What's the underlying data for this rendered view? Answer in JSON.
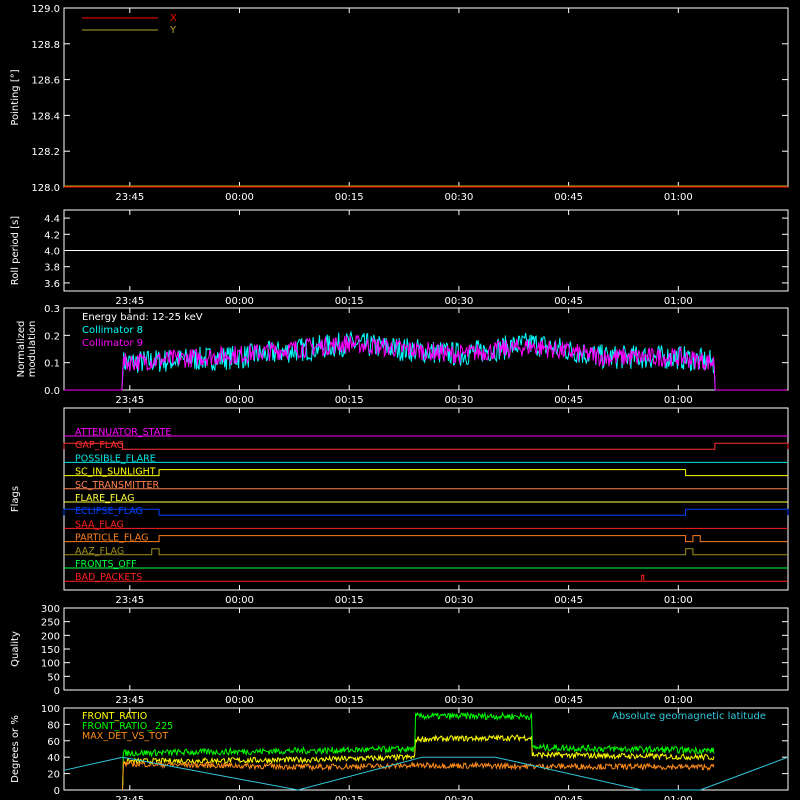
{
  "time_ticks": [
    "23:45",
    "00:00",
    "00:15",
    "00:30",
    "00:45",
    "01:00"
  ],
  "colors": {
    "background": "#000000",
    "axes": "#ffffff",
    "x": "#ff0000",
    "y": "#b5a32a",
    "roll": "#ffffff",
    "coll8": "#00ffff",
    "coll9": "#ff00ff",
    "front_ratio": "#ffff00",
    "front_ratio_225": "#00ff00",
    "max_det": "#ff8c1a",
    "geomag": "#32c8dc"
  },
  "chart_data": [
    {
      "id": "pointing",
      "type": "line",
      "ylabel": "Pointing [°]",
      "ylim": [
        128.0,
        129.0
      ],
      "yticks": [
        "128.0",
        "128.2",
        "128.4",
        "128.6",
        "128.8",
        "129.0"
      ],
      "legend": [
        "X",
        "Y"
      ],
      "series": [
        {
          "name": "X",
          "x": [
            "23:36",
            "01:15"
          ],
          "y": [
            128.0,
            128.0
          ]
        },
        {
          "name": "Y",
          "x": [
            "23:36",
            "01:15"
          ],
          "y": [
            128.0,
            128.0
          ]
        }
      ]
    },
    {
      "id": "roll",
      "type": "line",
      "ylabel": "Roll period [s]",
      "ylim": [
        3.5,
        4.5
      ],
      "yticks": [
        "3.6",
        "3.8",
        "4.0",
        "4.2",
        "4.4"
      ],
      "series": [
        {
          "x": [
            "23:36",
            "01:15"
          ],
          "y": [
            4.0,
            4.0
          ]
        }
      ]
    },
    {
      "id": "modulation",
      "type": "line",
      "ylabel": "Normalized modulation",
      "ylim": [
        0.0,
        0.3
      ],
      "yticks": [
        "0.0",
        "0.1",
        "0.2",
        "0.3"
      ],
      "annotation": "Energy band: 12-25 keV",
      "legend": [
        "Collimator 8",
        "Collimator 9"
      ],
      "series": [
        {
          "name": "Collimator 8",
          "x": [
            "23:36",
            "23:44",
            "23:44",
            "00:00",
            "00:15",
            "00:30",
            "00:40",
            "00:50",
            "01:00",
            "01:05",
            "01:05",
            "01:15"
          ],
          "y": [
            0.0,
            0.0,
            0.1,
            0.12,
            0.17,
            0.13,
            0.17,
            0.12,
            0.12,
            0.1,
            0.0,
            0.0
          ]
        },
        {
          "name": "Collimator 9",
          "x": [
            "23:36",
            "23:44",
            "23:44",
            "00:00",
            "00:15",
            "00:30",
            "00:40",
            "00:50",
            "01:00",
            "01:05",
            "01:05",
            "01:15"
          ],
          "y": [
            0.0,
            0.0,
            0.1,
            0.13,
            0.17,
            0.13,
            0.16,
            0.12,
            0.12,
            0.1,
            0.0,
            0.0
          ]
        }
      ]
    },
    {
      "id": "flags",
      "type": "line",
      "ylabel": "Flags",
      "flags": [
        {
          "name": "ATTENUATOR_STATE",
          "color": "#ff00ff",
          "on": []
        },
        {
          "name": "GAP_FLAG",
          "color": "#ff3030",
          "on": [
            [
              "23:36",
              "23:44"
            ],
            [
              "01:05",
              "01:15"
            ]
          ]
        },
        {
          "name": "POSSIBLE_FLARE",
          "color": "#00e5e5",
          "on": []
        },
        {
          "name": "SC_IN_SUNLIGHT",
          "color": "#ffff00",
          "on": [
            [
              "23:49",
              "01:01"
            ]
          ]
        },
        {
          "name": "SC_TRANSMITTER",
          "color": "#ff7f50",
          "on": []
        },
        {
          "name": "FLARE_FLAG",
          "color": "#ffff40",
          "on": []
        },
        {
          "name": "ECLIPSE_FLAG",
          "color": "#0040ff",
          "on": [
            [
              "23:36",
              "23:49"
            ],
            [
              "01:01",
              "01:15"
            ]
          ]
        },
        {
          "name": "SAA_FLAG",
          "color": "#ff2020",
          "on": []
        },
        {
          "name": "PARTICLE_FLAG",
          "color": "#ff7f20",
          "on": [
            [
              "23:49",
              "01:01"
            ],
            [
              "01:02",
              "01:03"
            ]
          ]
        },
        {
          "name": "AAZ_FLAG",
          "color": "#a09020",
          "on": [
            [
              "23:48",
              "23:49"
            ],
            [
              "01:01",
              "01:02"
            ]
          ]
        },
        {
          "name": "FRONTS_OFF",
          "color": "#00ff40",
          "on": []
        },
        {
          "name": "BAD_PACKETS",
          "color": "#ff2020",
          "on": [
            [
              "00:55",
              "00:55"
            ]
          ]
        }
      ]
    },
    {
      "id": "quality",
      "type": "line",
      "ylabel": "Quality",
      "ylim": [
        0,
        300
      ],
      "yticks": [
        "0",
        "50",
        "100",
        "150",
        "200",
        "250",
        "300"
      ],
      "series": []
    },
    {
      "id": "ratios",
      "type": "line",
      "ylabel": "Degrees or %",
      "ylim": [
        0,
        100
      ],
      "yticks": [
        "0",
        "20",
        "40",
        "60",
        "80",
        "100"
      ],
      "annotation": "Absolute geomagnetic latitude",
      "legend": [
        "FRONT_RATIO",
        "FRONT_RATIO_ 225",
        "MAX_DET_VS_TOT"
      ],
      "series": [
        {
          "name": "FRONT_RATIO",
          "x": [
            "23:44",
            "23:44",
            "00:10",
            "00:24",
            "00:24",
            "00:40",
            "00:40",
            "01:05"
          ],
          "y": [
            0,
            35,
            37,
            40,
            62,
            64,
            43,
            40
          ]
        },
        {
          "name": "FRONT_RATIO_ 225",
          "x": [
            "23:44",
            "23:44",
            "00:10",
            "00:24",
            "00:24",
            "00:40",
            "00:40",
            "01:05"
          ],
          "y": [
            0,
            45,
            48,
            50,
            90,
            90,
            52,
            48
          ]
        },
        {
          "name": "MAX_DET_VS_TOT",
          "x": [
            "23:44",
            "23:44",
            "00:10",
            "00:25",
            "00:40",
            "01:05"
          ],
          "y": [
            0,
            32,
            28,
            30,
            29,
            28
          ]
        },
        {
          "name": "Absolute geomagnetic latitude",
          "x": [
            "23:36",
            "23:44",
            "00:08",
            "00:25",
            "00:35",
            "00:55",
            "01:03",
            "01:15"
          ],
          "y": [
            24,
            40,
            0,
            40,
            40,
            0,
            0,
            40
          ]
        }
      ]
    }
  ]
}
